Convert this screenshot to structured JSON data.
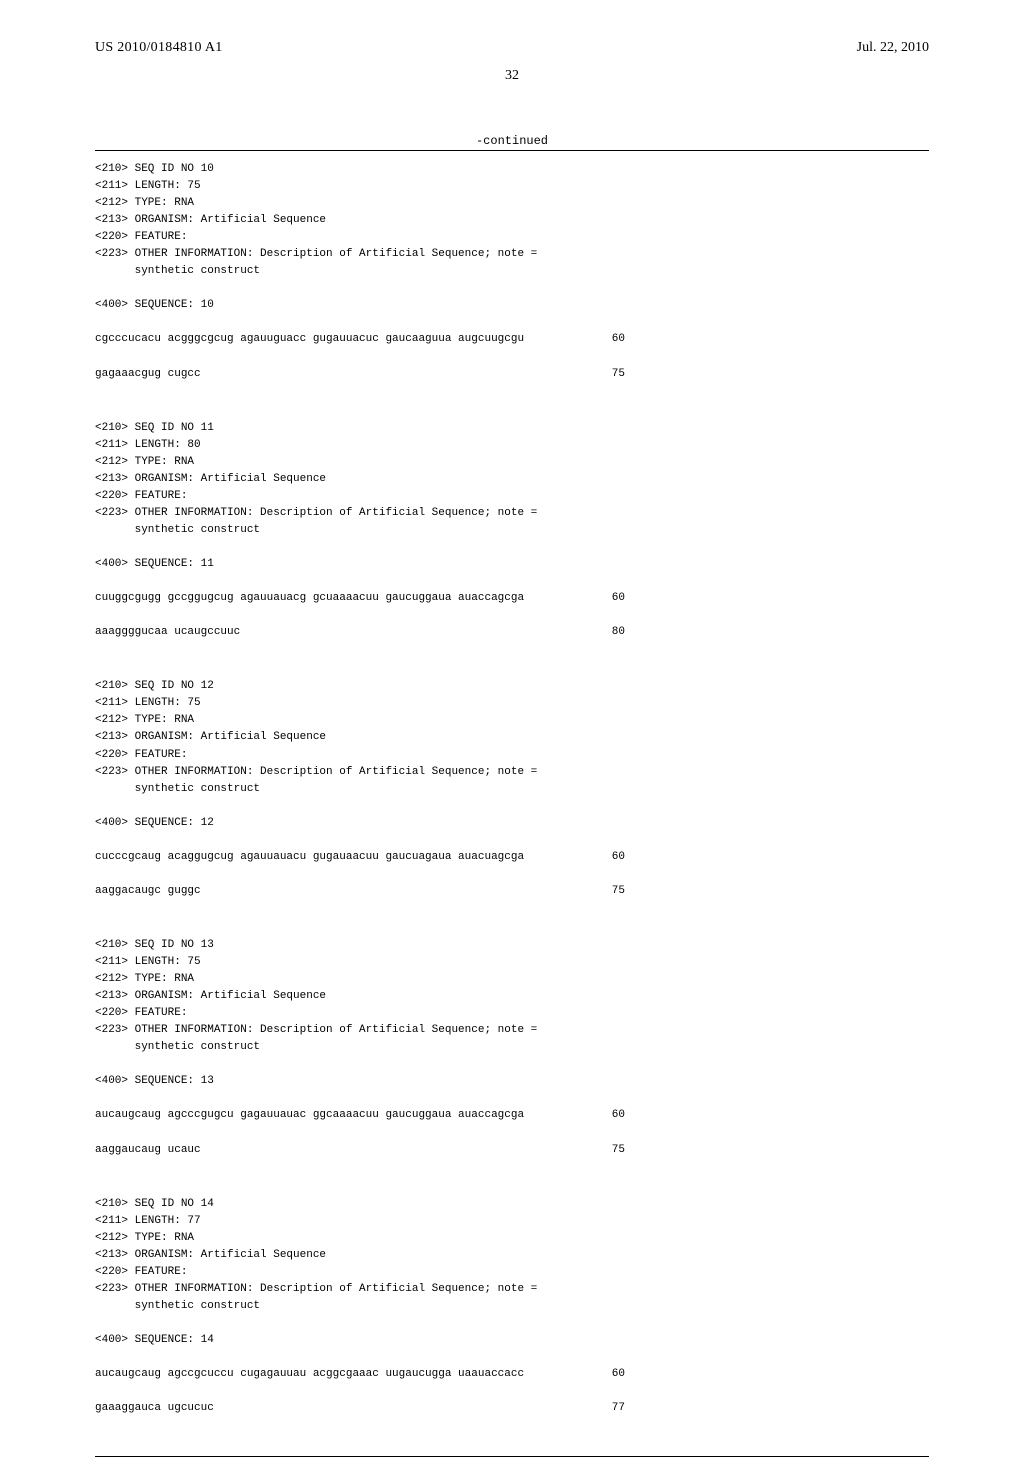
{
  "header": {
    "pub_number": "US 2010/0184810 A1",
    "pub_date": "Jul. 22, 2010"
  },
  "page_number": "32",
  "continued": "-continued",
  "sequences": [
    {
      "tags": [
        "<210> SEQ ID NO 10",
        "<211> LENGTH: 75",
        "<212> TYPE: RNA",
        "<213> ORGANISM: Artificial Sequence",
        "<220> FEATURE:",
        "<223> OTHER INFORMATION: Description of Artificial Sequence; note =",
        "      synthetic construct"
      ],
      "seq_label": "<400> SEQUENCE: 10",
      "lines": [
        {
          "text": "cgcccucacu acgggcgcug agauuguacc gugauuacuc gaucaaguua augcuugcgu",
          "num": "60"
        },
        {
          "text": "gagaaacgug cugcc",
          "num": "75"
        }
      ]
    },
    {
      "tags": [
        "<210> SEQ ID NO 11",
        "<211> LENGTH: 80",
        "<212> TYPE: RNA",
        "<213> ORGANISM: Artificial Sequence",
        "<220> FEATURE:",
        "<223> OTHER INFORMATION: Description of Artificial Sequence; note =",
        "      synthetic construct"
      ],
      "seq_label": "<400> SEQUENCE: 11",
      "lines": [
        {
          "text": "cuuggcgugg gccggugcug agauuauacg gcuaaaacuu gaucuggaua auaccagcga",
          "num": "60"
        },
        {
          "text": "aaaggggucaa ucaugccuuc",
          "num": "80"
        }
      ]
    },
    {
      "tags": [
        "<210> SEQ ID NO 12",
        "<211> LENGTH: 75",
        "<212> TYPE: RNA",
        "<213> ORGANISM: Artificial Sequence",
        "<220> FEATURE:",
        "<223> OTHER INFORMATION: Description of Artificial Sequence; note =",
        "      synthetic construct"
      ],
      "seq_label": "<400> SEQUENCE: 12",
      "lines": [
        {
          "text": "cucccgcaug acaggugcug agauuauacu gugauaacuu gaucuagaua auacuagcga",
          "num": "60"
        },
        {
          "text": "aaggacaugc guggc",
          "num": "75"
        }
      ]
    },
    {
      "tags": [
        "<210> SEQ ID NO 13",
        "<211> LENGTH: 75",
        "<212> TYPE: RNA",
        "<213> ORGANISM: Artificial Sequence",
        "<220> FEATURE:",
        "<223> OTHER INFORMATION: Description of Artificial Sequence; note =",
        "      synthetic construct"
      ],
      "seq_label": "<400> SEQUENCE: 13",
      "lines": [
        {
          "text": "aucaugcaug agcccgugcu gagauuauac ggcaaaacuu gaucuggaua auaccagcga",
          "num": "60"
        },
        {
          "text": "aaggaucaug ucauc",
          "num": "75"
        }
      ]
    },
    {
      "tags": [
        "<210> SEQ ID NO 14",
        "<211> LENGTH: 77",
        "<212> TYPE: RNA",
        "<213> ORGANISM: Artificial Sequence",
        "<220> FEATURE:",
        "<223> OTHER INFORMATION: Description of Artificial Sequence; note =",
        "      synthetic construct"
      ],
      "seq_label": "<400> SEQUENCE: 14",
      "lines": [
        {
          "text": "aucaugcaug agccgcuccu cugagauuau acggcgaaac uugaucugga uaauaccacc",
          "num": "60"
        },
        {
          "text": "gaaaggauca ugcucuc",
          "num": "77"
        }
      ]
    }
  ]
}
